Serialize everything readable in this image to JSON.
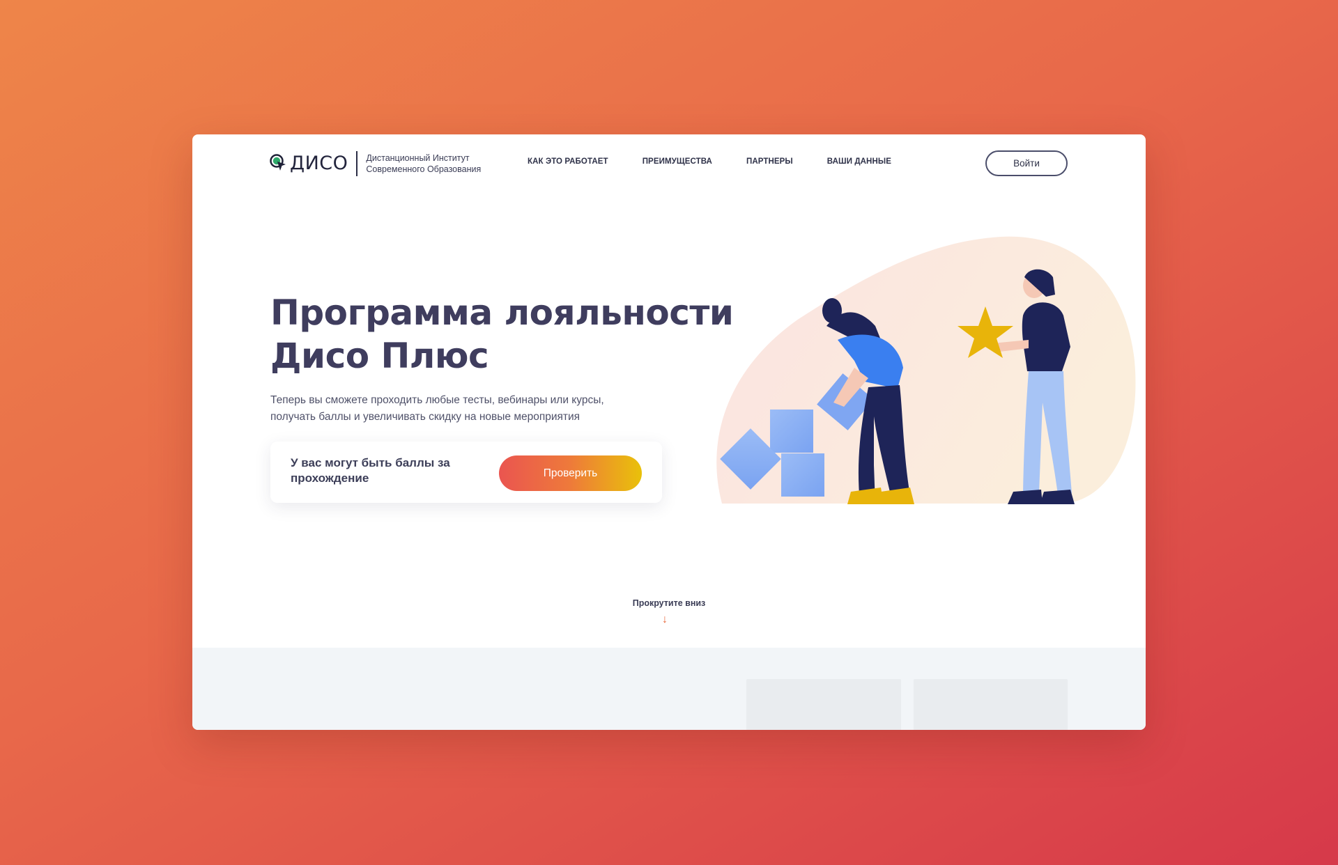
{
  "logo": {
    "word": "ДИСО",
    "subtitle_line1": "Дистанционный Институт",
    "subtitle_line2": "Современного Образования"
  },
  "nav": {
    "items": [
      {
        "label": "КАК ЭТО РАБОТАЕТ"
      },
      {
        "label": "ПРЕИМУЩЕСТВА"
      },
      {
        "label": "ПАРТНЕРЫ"
      },
      {
        "label": "ВАШИ ДАННЫЕ"
      }
    ],
    "login_label": "Войти"
  },
  "hero": {
    "title_line1": "Программа лояльности",
    "title_line2": "Дисо Плюс",
    "subtitle_line1": "Теперь вы сможете проходить любые тесты, вебинары или курсы,",
    "subtitle_line2": "получать баллы и увеличивать скидку на новые мероприятия",
    "card_text": "У вас могут быть баллы за прохождение",
    "check_label": "Проверить"
  },
  "scroll": {
    "label": "Прокрутите вниз",
    "arrow": "↓"
  },
  "colors": {
    "accent_orange": "#e8683a",
    "text_dark": "#3f3d5e",
    "button_gradient_start": "#ea5550",
    "button_gradient_end": "#e9c10a",
    "logo_green": "#2ea86a"
  },
  "icons": {
    "logo_mark": "location-pin-cursor-icon",
    "scroll": "arrow-down-icon"
  }
}
